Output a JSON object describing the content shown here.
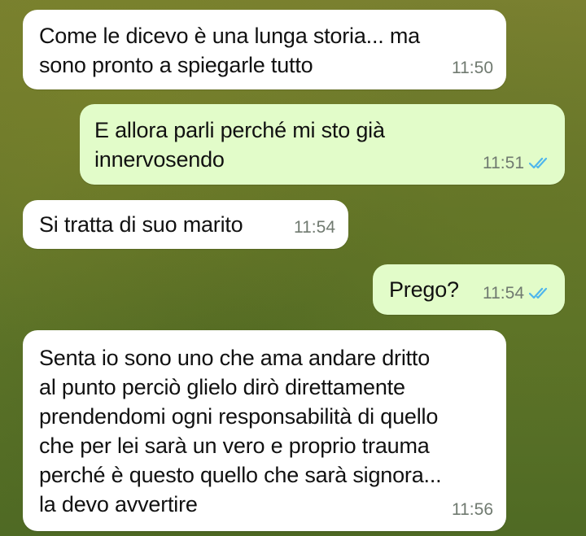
{
  "messages": [
    {
      "direction": "incoming",
      "text": "Come le dicevo è una lunga storia... ma\nsono pronto a spiegarle tutto",
      "time": "11:50"
    },
    {
      "direction": "outgoing",
      "text": "E allora parli perché mi sto già\ninnervosendo",
      "time": "11:51",
      "status": "read"
    },
    {
      "direction": "incoming",
      "text": "Si tratta di suo marito",
      "time": "11:54"
    },
    {
      "direction": "outgoing",
      "text": "Prego?",
      "time": "11:54",
      "status": "read"
    },
    {
      "direction": "incoming",
      "text": "Senta io sono uno che ama andare dritto\nal punto perciò glielo dirò direttamente\nprendendomi ogni responsabilità di quello\nche per lei sarà un vero e proprio trauma\nperché è questo quello che sarà signora...\nla devo avvertire",
      "time": "11:56"
    }
  ],
  "colors": {
    "incoming_bubble": "#ffffff",
    "outgoing_bubble": "#e2fcc9",
    "read_ticks": "#4fb6ec",
    "time_text": "#707a70"
  },
  "icons": {
    "read_status": "double-check-icon"
  }
}
